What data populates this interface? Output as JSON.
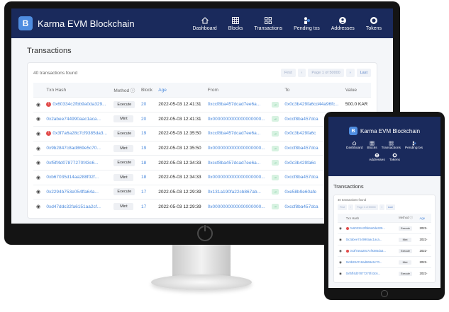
{
  "brand": {
    "logo_letter": "B",
    "name": "Karma EVM Blockchain"
  },
  "nav": [
    {
      "label": "Dashboard",
      "icon": "home-icon"
    },
    {
      "label": "Blocks",
      "icon": "grid-icon"
    },
    {
      "label": "Transactions",
      "icon": "squares-icon"
    },
    {
      "label": "Pending txs",
      "icon": "pending-icon"
    },
    {
      "label": "Addresses",
      "icon": "user-icon"
    },
    {
      "label": "Tokens",
      "icon": "token-icon"
    }
  ],
  "page_title": "Transactions",
  "found_text": "40 transactions found",
  "pager": {
    "first": "First",
    "prev": "‹",
    "page": "Page 1 of 50000",
    "next": "›",
    "last": "Last"
  },
  "columns": [
    "Txn Hash",
    "Method ⓘ",
    "Block",
    "Age",
    "From",
    "To",
    "Value"
  ],
  "rows": [
    {
      "error": true,
      "hash": "0x60334c2fbb9a0da329...",
      "method": "Execute",
      "block": "20",
      "age": "2022-05-03 12:41:31",
      "from": "0xccf8ba457dcad7ee6a...",
      "to": "0x0c3b429fa6cd44a96fc...",
      "value": "500.0 KAR"
    },
    {
      "error": false,
      "hash": "0x2abee744990aac1aca...",
      "method": "Mint",
      "block": "20",
      "age": "2022-05-03 12:41:31",
      "from": "0x0000000000000000000...",
      "to": "0xccf8ba457dca",
      "value": ""
    },
    {
      "error": true,
      "hash": "0x3f7a6a28c7cf9385da3...",
      "method": "Execute",
      "block": "19",
      "age": "2022-05-03 12:35:50",
      "from": "0xccf8ba457dcad7ee6a...",
      "to": "0x0c3b429fa6c",
      "value": ""
    },
    {
      "error": false,
      "hash": "0x9b2847c8ad869e5c70...",
      "method": "Mint",
      "block": "19",
      "age": "2022-05-03 12:35:50",
      "from": "0x0000000000000000000...",
      "to": "0xccf8ba457dca",
      "value": ""
    },
    {
      "error": false,
      "hash": "0xf5ff4d07877270f43c6...",
      "method": "Execute",
      "block": "18",
      "age": "2022-05-03 12:34:33",
      "from": "0xccf8ba457dcad7ee6a...",
      "to": "0x0c3b429fa6c",
      "value": ""
    },
    {
      "error": false,
      "hash": "0xb67035d14aa288f02f...",
      "method": "Mint",
      "block": "18",
      "age": "2022-05-03 12:34:33",
      "from": "0x0000000000000000000...",
      "to": "0xccf8ba457dca",
      "value": ""
    },
    {
      "error": false,
      "hash": "0x2294b753e054ffa64a...",
      "method": "Execute",
      "block": "17",
      "age": "2022-05-03 12:29:39",
      "from": "0x131a190fa22cb867ab...",
      "to": "0xe58b9e60afe",
      "value": ""
    },
    {
      "error": false,
      "hash": "0xd47ddc32fa6151aa2cf...",
      "method": "Mint",
      "block": "17",
      "age": "2022-05-03 12:29:39",
      "from": "0x0000000000000000000...",
      "to": "0xccf8ba457dca",
      "value": ""
    }
  ],
  "tablet": {
    "nav_row1": [
      {
        "label": "Dashboard",
        "icon": "home-icon"
      },
      {
        "label": "Blocks",
        "icon": "grid-icon"
      },
      {
        "label": "Transactions",
        "icon": "squares-icon"
      },
      {
        "label": "Pending txs",
        "icon": "pending-icon"
      }
    ],
    "nav_row2": [
      {
        "label": "Addresses",
        "icon": "user-icon"
      },
      {
        "label": "Tokens",
        "icon": "token-icon"
      }
    ],
    "pager": {
      "first": "First",
      "prev": "‹",
      "page": "Page 1 of 50000",
      "next": "›",
      "last": "Last"
    },
    "columns": [
      "Txn Hash",
      "Method ⓘ",
      "Age"
    ],
    "rows": [
      {
        "error": true,
        "hash": "0x60334c2fbb9a0da329...",
        "method": "Execute",
        "age": "2022-"
      },
      {
        "error": false,
        "hash": "0x2abee744990aac1aca...",
        "method": "Mint",
        "age": "2022-"
      },
      {
        "error": true,
        "hash": "0x3f7a6a28c7cf9385da3...",
        "method": "Execute",
        "age": "2022-"
      },
      {
        "error": false,
        "hash": "0x9b2847c8ad869e5c70...",
        "method": "Mint",
        "age": "2022-"
      },
      {
        "error": false,
        "hash": "0xf5ff4d07877270f43c6...",
        "method": "Execute",
        "age": "2022-"
      }
    ]
  },
  "colors": {
    "navbar": "#1a2a5c",
    "accent": "#4a89dc",
    "error": "#e24c4b",
    "arrow": "#2eaa62"
  }
}
